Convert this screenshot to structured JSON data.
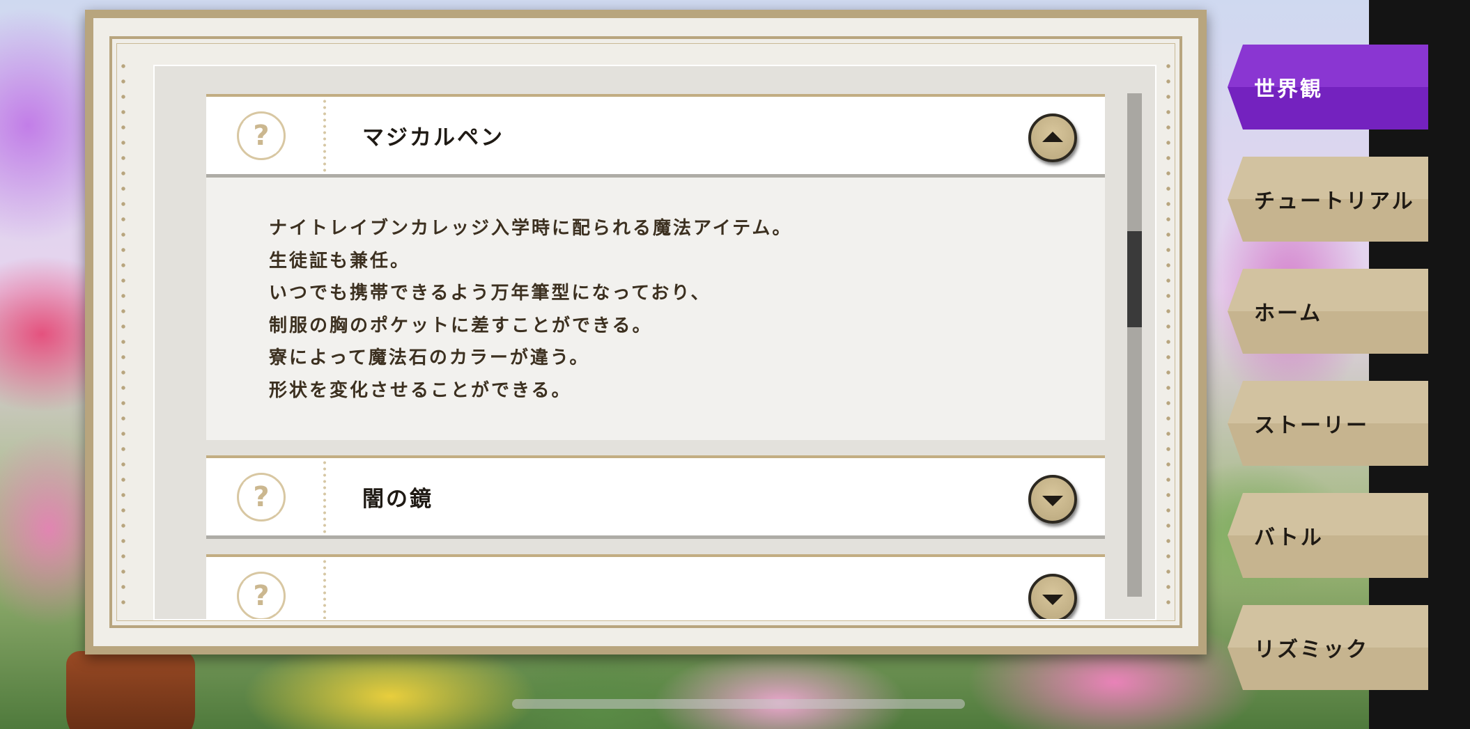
{
  "accordion": {
    "items": [
      {
        "title": "マジカルペン",
        "expanded": true,
        "body_lines": [
          "ナイトレイブンカレッジ入学時に配られる魔法アイテム。",
          "生徒証も兼任。",
          "いつでも携帯できるよう万年筆型になっており、",
          "制服の胸のポケットに差すことができる。",
          "寮によって魔法石のカラーが違う。",
          "形状を変化させることができる。"
        ]
      },
      {
        "title": "闇の鏡",
        "expanded": false
      }
    ],
    "icon": "question-mark-icon"
  },
  "nav": {
    "tabs": [
      {
        "label": "世界観",
        "active": true
      },
      {
        "label": "チュートリアル",
        "active": false
      },
      {
        "label": "ホーム",
        "active": false
      },
      {
        "label": "ストーリー",
        "active": false
      },
      {
        "label": "バトル",
        "active": false
      },
      {
        "label": "リズミック",
        "active": false
      }
    ]
  },
  "colors": {
    "accent_active_tab": "#7f2dc8",
    "tab_inactive": "#cdbd9a",
    "panel_frame": "#b8a57e",
    "text_dark": "#1f1a14"
  }
}
